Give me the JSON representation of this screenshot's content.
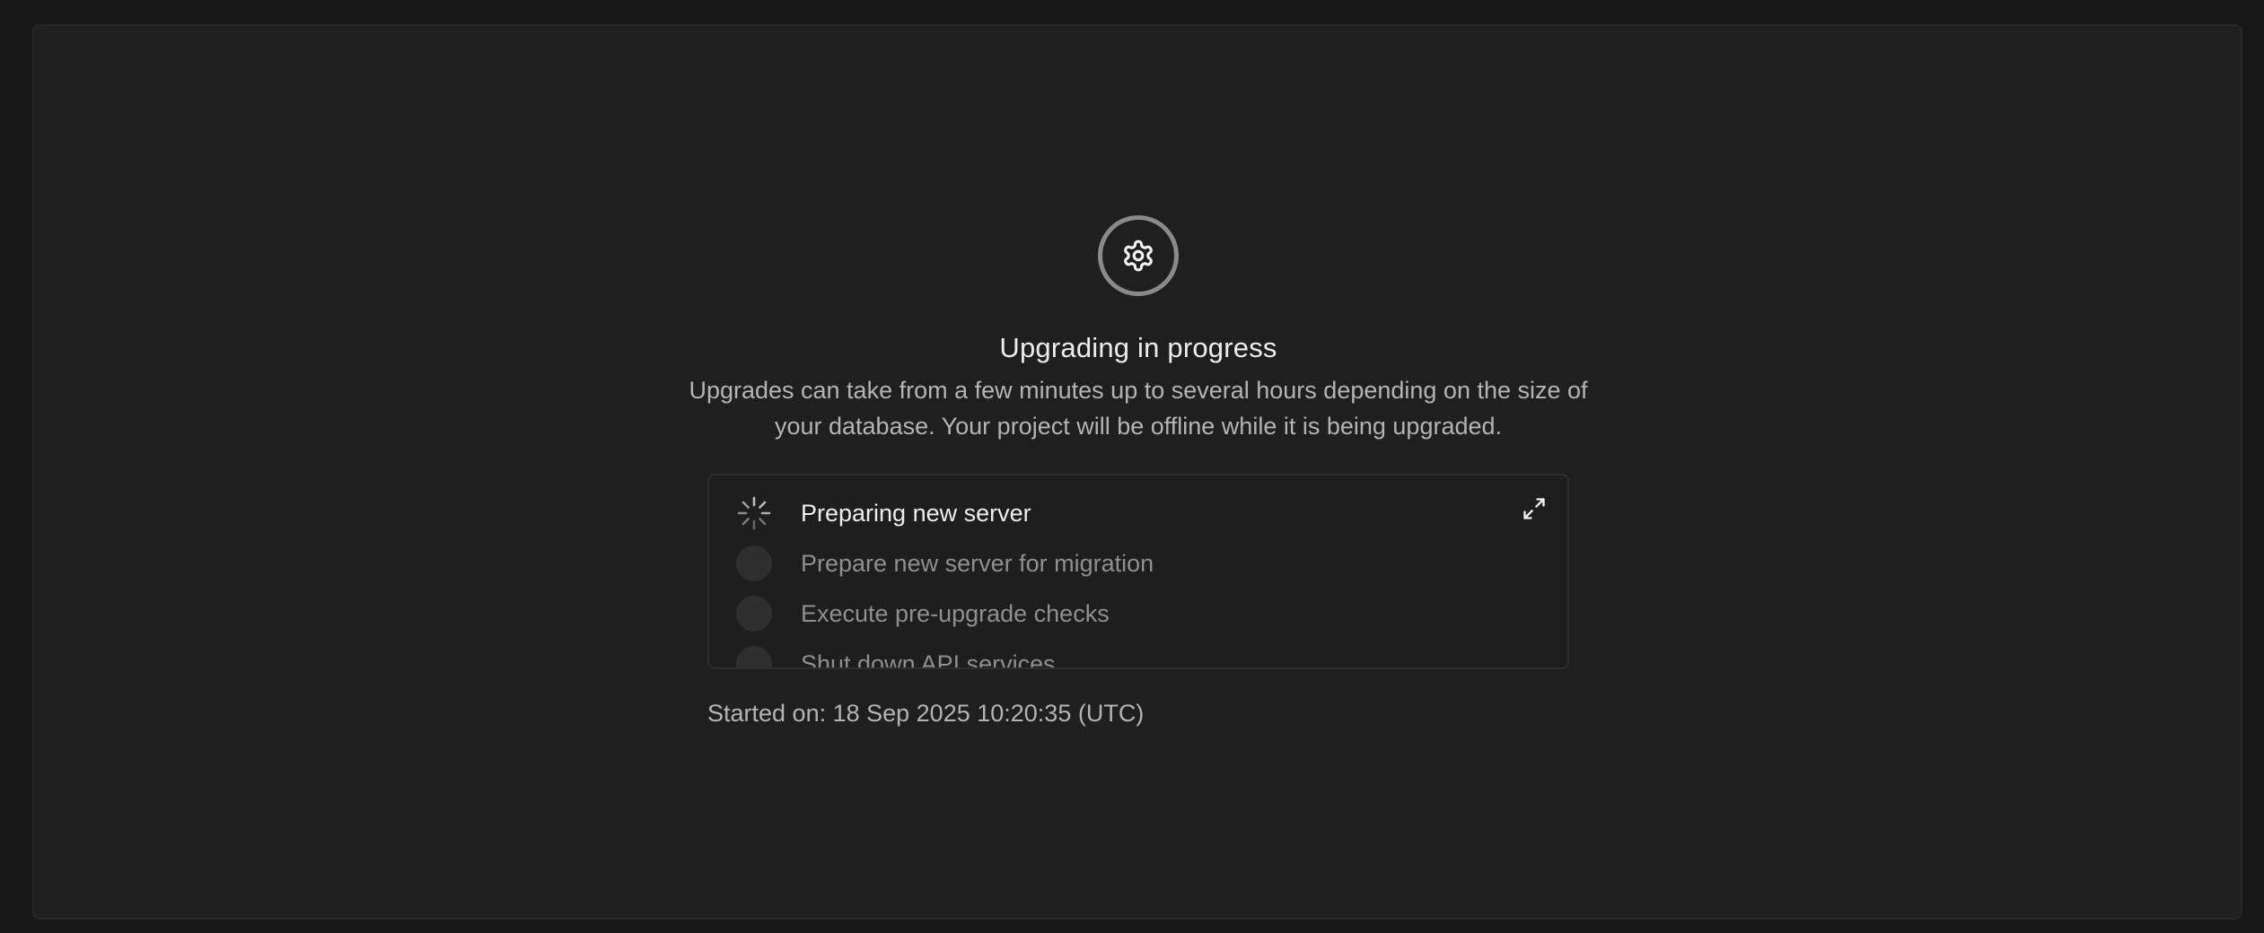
{
  "status": {
    "title": "Upgrading in progress",
    "description": "Upgrades can take from a few minutes up to several hours depending on the size of your database. Your project will be offline while it is being upgraded.",
    "icon": "gear-icon"
  },
  "steps": [
    {
      "label": "Preparing new server",
      "state": "in-progress"
    },
    {
      "label": "Prepare new server for migration",
      "state": "pending"
    },
    {
      "label": "Execute pre-upgrade checks",
      "state": "pending"
    },
    {
      "label": "Shut down API services",
      "state": "pending"
    }
  ],
  "footer": {
    "started_on": "Started on: 18 Sep 2025 10:20:35 (UTC)"
  },
  "colors": {
    "background": "#171717",
    "panel": "#1f1f1f",
    "text_primary": "#ededed",
    "text_secondary": "#b4b4b4",
    "text_muted": "#8f8f8f"
  }
}
